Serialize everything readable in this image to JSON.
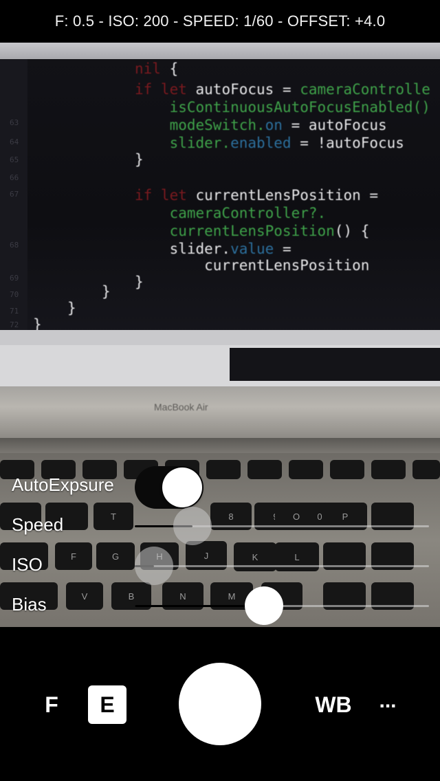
{
  "status": {
    "readout": "F: 0.5 - ISO: 200 - SPEED: 1/60 - OFFSET: +4.0"
  },
  "preview": {
    "code_lines": [
      {
        "parts": [
          {
            "t": "nil",
            "c": "c-red"
          },
          {
            "t": " {",
            "c": "c-white"
          }
        ]
      },
      {
        "parts": [
          {
            "t": "if let ",
            "c": "c-red"
          },
          {
            "t": "autoFocus",
            "c": "c-white"
          },
          {
            "t": " = ",
            "c": "c-white"
          },
          {
            "t": "cameraControlle",
            "c": "c-green"
          }
        ]
      },
      {
        "parts": [
          {
            "t": "    isContinuousAutoFocusEnabled()",
            "c": "c-green"
          }
        ]
      },
      {
        "parts": [
          {
            "t": "    modeSwitch.",
            "c": "c-green"
          },
          {
            "t": "on",
            "c": "c-blue"
          },
          {
            "t": " = autoFocus",
            "c": "c-white"
          }
        ]
      },
      {
        "parts": [
          {
            "t": "    slider.",
            "c": "c-green"
          },
          {
            "t": "enabled",
            "c": "c-blue"
          },
          {
            "t": " = !autoFocus",
            "c": "c-white"
          }
        ]
      },
      {
        "parts": [
          {
            "t": "}",
            "c": "c-white"
          }
        ]
      },
      {
        "parts": [
          {
            "t": "",
            "c": "c-white"
          }
        ]
      },
      {
        "parts": [
          {
            "t": "if let ",
            "c": "c-red"
          },
          {
            "t": "currentLensPosition",
            "c": "c-white"
          },
          {
            "t": " =",
            "c": "c-white"
          }
        ]
      },
      {
        "parts": [
          {
            "t": "    cameraController?.",
            "c": "c-green"
          }
        ]
      },
      {
        "parts": [
          {
            "t": "    currentLensPosition",
            "c": "c-green"
          },
          {
            "t": "() {",
            "c": "c-white"
          }
        ]
      },
      {
        "parts": [
          {
            "t": "    slider.",
            "c": "c-white"
          },
          {
            "t": "value",
            "c": "c-blue"
          },
          {
            "t": " =",
            "c": "c-white"
          }
        ]
      },
      {
        "parts": [
          {
            "t": "        currentLensPosition",
            "c": "c-white"
          }
        ]
      },
      {
        "parts": [
          {
            "t": "}",
            "c": "c-white"
          }
        ]
      }
    ],
    "closing_braces": [
      "}",
      "}",
      "}"
    ],
    "line_numbers": [
      "63",
      "64",
      "65",
      "66",
      "67",
      "68",
      "69",
      "70",
      "71",
      "72"
    ],
    "laptop_label": "MacBook Air",
    "keys": [
      "T",
      "F",
      "G",
      "H",
      "J",
      "K",
      "V",
      "B",
      "N",
      "M",
      "8",
      "9",
      "0",
      "O",
      "P",
      "L"
    ]
  },
  "controls": {
    "auto_exposure": {
      "label": "AutoExpsure",
      "on": true
    },
    "speed": {
      "label": "Speed",
      "level": 0.15
    },
    "iso": {
      "label": "ISO",
      "level": 0.0
    },
    "bias": {
      "label": "Bias",
      "level": 0.43
    }
  },
  "bottom_bar": {
    "f_label": "F",
    "e_label": "E",
    "wb_label": "WB",
    "more_label": "..."
  }
}
